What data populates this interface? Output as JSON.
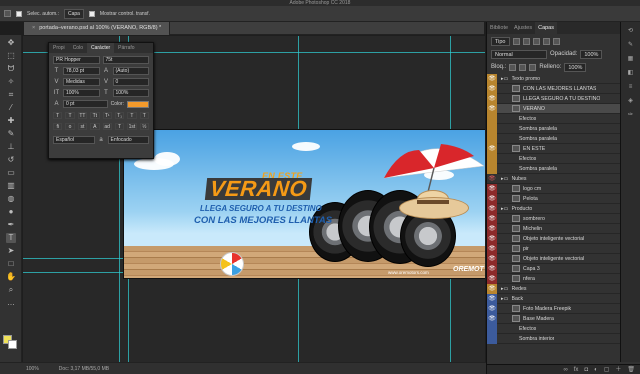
{
  "app": {
    "title": "Adobe Photoshop CC 2018"
  },
  "options": {
    "tool": "Selec. autom.:",
    "target": "Capa",
    "show_transform": "Mostrar control. transf."
  },
  "document": {
    "tab_label": "portada–verano.psd al 100% (VERANO, RGB/8) *",
    "zoom": "100%",
    "doc_size": "Doc: 3,17 MB/55,0 MB"
  },
  "character_panel": {
    "tabs": [
      "Propi",
      "Colo",
      "Carácter",
      "Párrafo"
    ],
    "active_tab": "Carácter",
    "font_family": "PR Hopper",
    "font_style": "75t",
    "font_size": "78,03 pt",
    "leading": "(Auto)",
    "kerning": "Medidas",
    "tracking": "0",
    "vertical_scale": "100%",
    "horizontal_scale": "100%",
    "baseline_shift": "0 pt",
    "color_label": "Color:",
    "type_buttons": [
      "T",
      "T",
      "TT",
      "Tt",
      "T¹",
      "T₁",
      "T",
      "T"
    ],
    "extra_buttons": [
      "fi",
      "o",
      "st",
      "A",
      "ad",
      "T",
      "1st",
      "½"
    ],
    "language": "Español",
    "antialias": "Enfocado",
    "text_color": "#f39a2c"
  },
  "banner": {
    "headline_small": "EN ESTE",
    "headline_big": "VERANO",
    "tagline_1": "LLEGA SEGURO A TU DESTINO",
    "tagline_2": "CON LAS MEJORES LLANTAS",
    "url": "www.oremotors.com",
    "brand": "OREMOT"
  },
  "layers_panel": {
    "tabs": [
      "Bibliote",
      "Ajustes",
      "Capas"
    ],
    "active_tab": "Capas",
    "kind_filter": "Tipo",
    "blend_mode": "Normal",
    "opacity_label": "Opacidad:",
    "opacity": "100%",
    "fill_label": "Relleno:",
    "fill": "100%",
    "lock_label": "Bloq.:",
    "layers": [
      {
        "name": "Texto promo",
        "color": "gold",
        "kind": "group"
      },
      {
        "name": "CON LAS MEJORES LLANTAS",
        "color": "gold",
        "kind": "text"
      },
      {
        "name": "LLEGA SEGURO A TU DESTINO",
        "color": "gold",
        "kind": "text"
      },
      {
        "name": "VERANO",
        "color": "gold",
        "kind": "text",
        "fx": "fx"
      },
      {
        "name": "Efectos",
        "color": "gold",
        "kind": "effect"
      },
      {
        "name": "Sombra paralela",
        "color": "gold",
        "kind": "effect"
      },
      {
        "name": "Sombra paralela",
        "color": "gold",
        "kind": "effect"
      },
      {
        "name": "EN ESTE",
        "color": "gold",
        "kind": "text",
        "fx": "fx"
      },
      {
        "name": "Efectos",
        "color": "gold",
        "kind": "effect"
      },
      {
        "name": "Sombra paralela",
        "color": "gold",
        "kind": "effect"
      },
      {
        "name": "Nubes",
        "color": "none",
        "kind": "group"
      },
      {
        "name": "logo cm",
        "color": "red",
        "kind": "layer",
        "fx": "fx"
      },
      {
        "name": "Pelota",
        "color": "red",
        "kind": "layer",
        "fx": "fx"
      },
      {
        "name": "Producto",
        "color": "red",
        "kind": "group"
      },
      {
        "name": "sombrero",
        "color": "red",
        "kind": "layer"
      },
      {
        "name": "Michelin",
        "color": "red",
        "kind": "layer"
      },
      {
        "name": "Objeto inteligente vectorial",
        "color": "red",
        "kind": "layer"
      },
      {
        "name": "pir",
        "color": "red",
        "kind": "layer"
      },
      {
        "name": "Objeto inteligente vectorial",
        "color": "red",
        "kind": "layer"
      },
      {
        "name": "Capa 3",
        "color": "red",
        "kind": "layer"
      },
      {
        "name": "nfera",
        "color": "red",
        "kind": "layer"
      },
      {
        "name": "Redes",
        "color": "gold",
        "kind": "group"
      },
      {
        "name": "Back",
        "color": "blue",
        "kind": "group"
      },
      {
        "name": "Foto Madera Freepik",
        "color": "blue",
        "kind": "layer"
      },
      {
        "name": "Base Madera",
        "color": "blue",
        "kind": "layer",
        "fx": "fx"
      },
      {
        "name": "Efectos",
        "color": "blue",
        "kind": "effect"
      },
      {
        "name": "Sombra interior",
        "color": "blue",
        "kind": "effect"
      }
    ]
  }
}
